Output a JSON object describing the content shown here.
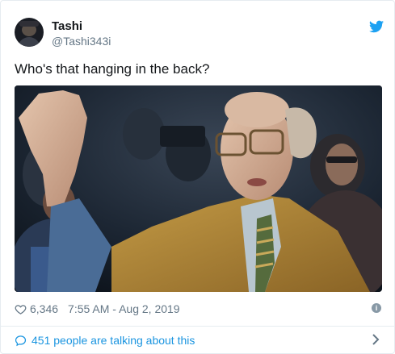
{
  "tweet": {
    "display_name": "Tashi",
    "handle": "@Tashi343i",
    "text": "Who's that hanging in the back?",
    "likes": "6,346",
    "timestamp": "7:55 AM - Aug 2, 2019",
    "conversation": "451 people are talking about this"
  },
  "icons": {
    "brand": "twitter-bird-icon",
    "like": "heart-icon",
    "info": "info-icon",
    "reply": "speech-bubble-icon",
    "more": "chevron-right-icon"
  },
  "colors": {
    "brand_blue": "#1da1f2",
    "link_blue": "#1b95e0",
    "secondary_text": "#657786",
    "primary_text": "#14171a",
    "border": "#e6ecf0"
  }
}
